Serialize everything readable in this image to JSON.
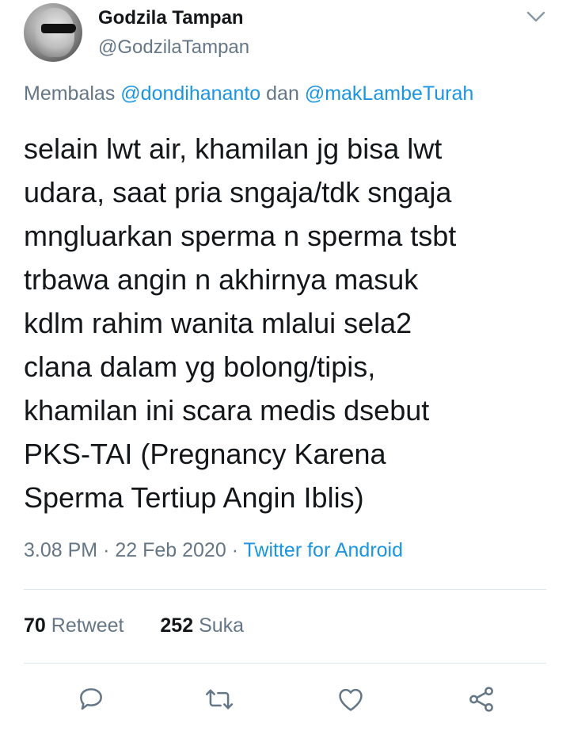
{
  "author": {
    "display_name": "Godzila Tampan",
    "handle": "@GodzilaTampan"
  },
  "reply": {
    "prefix": "Membalas",
    "mention1": "@dondihananto",
    "joiner": "dan",
    "mention2": "@makLambeTurah"
  },
  "tweet": {
    "lines": [
      "selain lwt air, khamilan jg bisa lwt",
      "udara, saat pria sngaja/tdk sngaja",
      "mngluarkan sperma n sperma tsbt",
      "trbawa angin n akhirnya masuk",
      "kdlm rahim wanita mlalui sela2",
      "clana dalam yg bolong/tipis,",
      "khamilan ini scara medis dsebut",
      "PKS-TAI (Pregnancy Karena",
      "Sperma Tertiup Angin Iblis)"
    ]
  },
  "meta": {
    "time": "3.08 PM",
    "sep1": "·",
    "date": "22 Feb 2020",
    "sep2": "·",
    "source": "Twitter for Android"
  },
  "stats": {
    "retweet_count": "70",
    "retweet_label": "Retweet",
    "like_count": "252",
    "like_label": "Suka"
  },
  "icons": {
    "menu": "chevron-down-icon",
    "reply": "reply-icon",
    "retweet": "retweet-icon",
    "like": "heart-icon",
    "share": "share-icon"
  },
  "colors": {
    "text": "#14171a",
    "secondary": "#657786",
    "link": "#1b95e0",
    "divider": "#e1e8ed"
  }
}
